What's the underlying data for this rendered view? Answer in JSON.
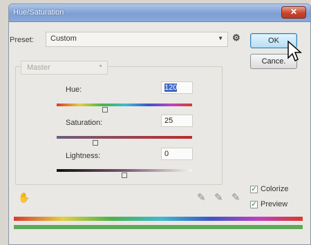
{
  "window": {
    "title": "Hue/Saturation",
    "close_symbol": "✕"
  },
  "preset": {
    "label": "Preset:",
    "value": "Custom",
    "arrow": "▼",
    "options_symbol": "⚙"
  },
  "buttons": {
    "ok": "OK",
    "cancel": "Cance."
  },
  "channel": {
    "value": "Master",
    "arrow": "▼"
  },
  "adjustments": {
    "hue": {
      "label": "Hue:",
      "value": "120"
    },
    "saturation": {
      "label": "Saturation:",
      "value": "25"
    },
    "lightness": {
      "label": "Lightness:",
      "value": "0"
    }
  },
  "options": {
    "colorize": {
      "label": "Colorize",
      "checked": true
    },
    "preview": {
      "label": "Preview",
      "checked": true
    }
  },
  "icons": {
    "hand": "✋",
    "eyedropper": "✎"
  },
  "colors": {
    "title_bar": "#7d9fd3",
    "ok_highlight": "#b6dff7",
    "selection": "#3d66c6",
    "close": "#c8442d"
  }
}
